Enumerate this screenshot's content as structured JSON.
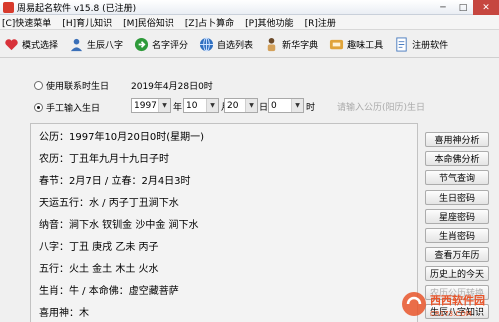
{
  "window": {
    "title": "周易起名软件 v15.8 (已注册)",
    "close_glyph": "✕",
    "minimize_glyph": "─",
    "maximize_glyph": "□"
  },
  "menu": [
    "[C]快速菜单",
    "[H]育儿知识",
    "[M]民俗知识",
    "[Z]占卜算命",
    "[P]其他功能",
    "[R]注册"
  ],
  "toolbar": [
    {
      "label": "模式选择",
      "icon": "heart-icon",
      "color": "#d8323a"
    },
    {
      "label": "生辰八字",
      "icon": "user-icon",
      "color": "#3a6fb8"
    },
    {
      "label": "名字评分",
      "icon": "arrow-right-icon",
      "color": "#2e9a3a"
    },
    {
      "label": "自选列表",
      "icon": "globe-icon",
      "color": "#2f6fc0"
    },
    {
      "label": "新华字典",
      "icon": "person-icon",
      "color": "#6b4a2a"
    },
    {
      "label": "趣味工具",
      "icon": "tools-icon",
      "color": "#c88a1c"
    },
    {
      "label": "注册软件",
      "icon": "document-icon",
      "color": "#4a7cc0"
    }
  ],
  "birth": {
    "option_contact": "使用联系时生日",
    "contact_date": "2019年4月28日0时",
    "option_manual": "手工输入生日",
    "year": "1997",
    "year_unit": "年",
    "month": "10",
    "month_unit": "月",
    "day": "20",
    "day_unit": "日",
    "hour": "0",
    "hour_unit": "时",
    "hint": "请输入公历(阳历)生日"
  },
  "info": [
    "公历：1997年10月20日0时(星期一)",
    "农历：丁丑年九月十九日子时",
    "春节：2月7日 / 立春：2月4日3时",
    "天运五行：水 / 丙子丁丑涧下水",
    "纳音：涧下水 钗钏金 沙中金 涧下水",
    "八字：丁丑 庚戌 乙未 丙子",
    "五行：火土 金土 木土 火水",
    "生肖：牛 / 本命佛：虚空藏菩萨",
    "喜用神：木"
  ],
  "side_buttons": [
    "喜用神分析",
    "本命佛分析",
    "节气查询",
    "生日密码",
    "星座密码",
    "生肖密码",
    "查看万年历",
    "历史上的今天",
    "农历公历转换",
    "生辰八字知识"
  ],
  "watermark": {
    "brand": "西西软件园",
    "url": "CR173.COM"
  }
}
